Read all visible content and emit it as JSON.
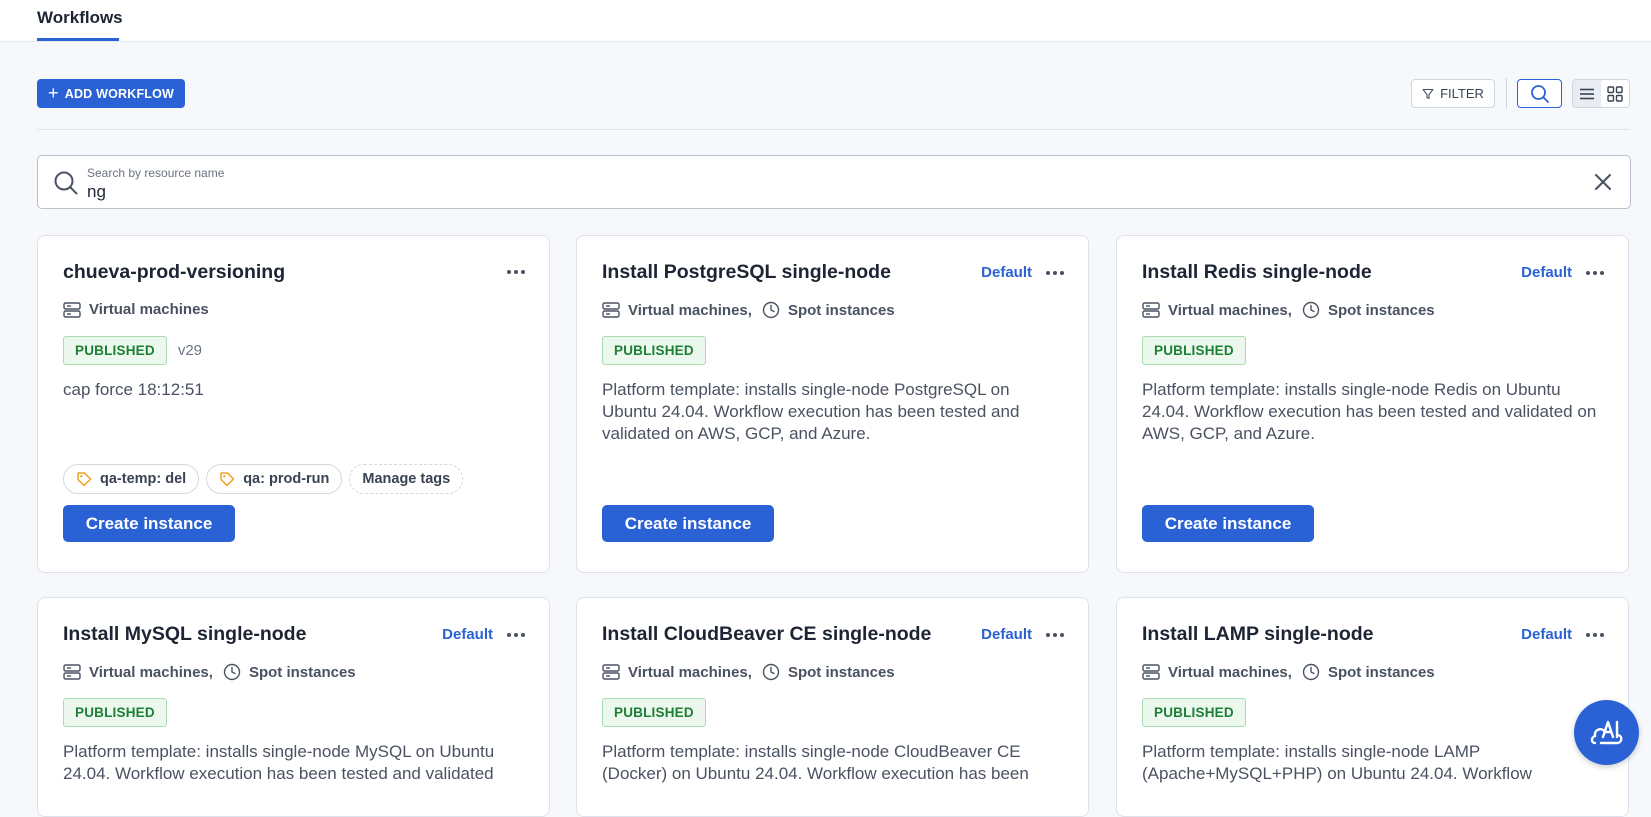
{
  "header": {
    "tab_label": "Workflows"
  },
  "toolbar": {
    "add_label": "ADD WORKFLOW",
    "filter_label": "FILTER"
  },
  "search": {
    "label": "Search by resource name",
    "value": "ng"
  },
  "cards": [
    {
      "title": "chueva-prod-versioning",
      "default_label": "",
      "meta": [
        "Virtual machines"
      ],
      "status": "PUBLISHED",
      "version": "v29",
      "description": "cap force 18:12:51",
      "tags": [
        "qa-temp: del",
        "qa: prod-run"
      ],
      "manage_tags_label": "Manage tags",
      "create_label": "Create instance"
    },
    {
      "title": "Install PostgreSQL single-node",
      "default_label": "Default",
      "meta": [
        "Virtual machines,",
        "Spot instances"
      ],
      "status": "PUBLISHED",
      "description": "Platform template: installs single-node PostgreSQL on Ubuntu 24.04. Workflow execution has been tested and validated on AWS, GCP, and Azure.",
      "create_label": "Create instance"
    },
    {
      "title": "Install Redis single-node",
      "default_label": "Default",
      "meta": [
        "Virtual machines,",
        "Spot instances"
      ],
      "status": "PUBLISHED",
      "description": "Platform template: installs single-node Redis on Ubuntu 24.04. Workflow execution has been tested and validated on AWS, GCP, and Azure.",
      "create_label": "Create instance"
    },
    {
      "title": "Install MySQL single-node",
      "default_label": "Default",
      "meta": [
        "Virtual machines,",
        "Spot instances"
      ],
      "status": "PUBLISHED",
      "description": "Platform template: installs single-node MySQL on Ubuntu 24.04. Workflow execution has been tested and validated"
    },
    {
      "title": "Install CloudBeaver CE single-node",
      "default_label": "Default",
      "meta": [
        "Virtual machines,",
        "Spot instances"
      ],
      "status": "PUBLISHED",
      "description": "Platform template: installs single-node CloudBeaver CE (Docker) on Ubuntu 24.04. Workflow execution has been"
    },
    {
      "title": "Install LAMP single-node",
      "default_label": "Default",
      "meta": [
        "Virtual machines,",
        "Spot instances"
      ],
      "status": "PUBLISHED",
      "description": "Platform template: installs single-node LAMP (Apache+MySQL+PHP) on Ubuntu 24.04. Workflow"
    }
  ],
  "colors": {
    "accent": "#2a62d6",
    "published_bg": "#ecf8ee",
    "published_text": "#1c7f34",
    "tag_icon": "#f0a020"
  },
  "icons": {
    "server": "server-icon",
    "clock": "clock-icon",
    "tag": "tag-icon",
    "ai": "ai-assistant-icon"
  }
}
